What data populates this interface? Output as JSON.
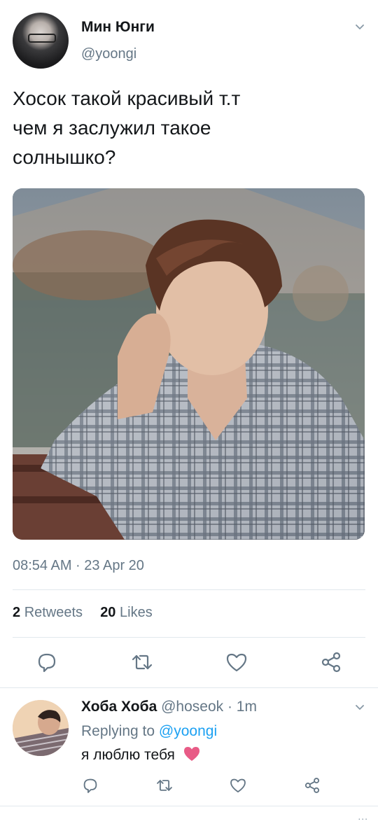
{
  "tweet": {
    "author_name": "Мин Юнги",
    "author_handle": "@yoongi",
    "text_lines": [
      "Хосок такой красивый т.т",
      "чем я заслужил такое",
      "солнышко?"
    ],
    "timestamp": "08:54 AM · 23 Apr 20",
    "retweets_count": "2",
    "retweets_label": "Retweets",
    "likes_count": "20",
    "likes_label": "Likes"
  },
  "reply": {
    "author_name": "Хоба Хоба",
    "author_handle": "@hoseok · 1m",
    "replying_to_label": "Replying to",
    "replying_to_handle": "@yoongi",
    "text": "я люблю тебя",
    "emoji": "pink-heart"
  },
  "icons": {
    "reply": "comment-icon",
    "retweet": "retweet-icon",
    "like": "heart-icon",
    "share": "share-icon",
    "menu": "chevron-down-icon"
  },
  "colors": {
    "accent": "#1da1f2",
    "secondary_text": "#657786",
    "heart": "#e0245e"
  },
  "footer": {
    "overflow": "..."
  }
}
